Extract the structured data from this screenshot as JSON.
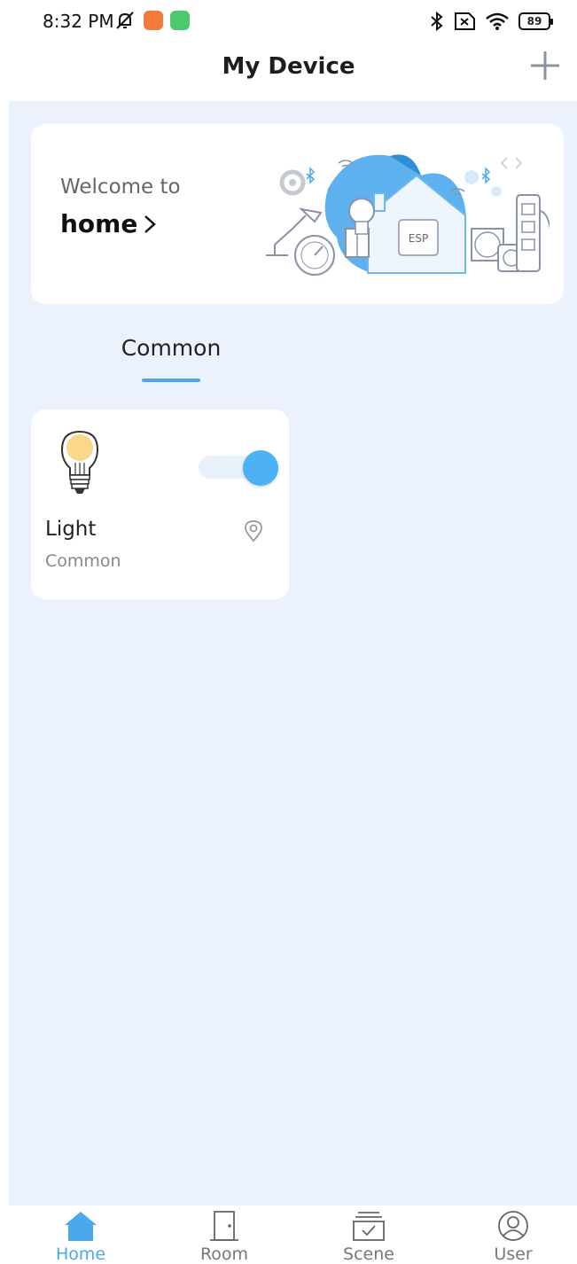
{
  "status_bar": {
    "time": "8:32 PM",
    "battery": "89"
  },
  "header": {
    "title": "My Device",
    "add_icon": "plus-icon"
  },
  "welcome": {
    "greeting": "Welcome to",
    "home_label": "home",
    "chevron": "›",
    "illustration_label": "ESP"
  },
  "tabs": [
    {
      "label": "Common",
      "active": true
    }
  ],
  "devices": [
    {
      "name": "Light",
      "room": "Common",
      "on": true,
      "icon": "lightbulb-icon"
    }
  ],
  "bottom_nav": {
    "items": [
      {
        "label": "Home",
        "icon": "home-icon",
        "active": true
      },
      {
        "label": "Room",
        "icon": "door-icon",
        "active": false
      },
      {
        "label": "Scene",
        "icon": "scene-icon",
        "active": false
      },
      {
        "label": "User",
        "icon": "user-icon",
        "active": false
      }
    ]
  },
  "colors": {
    "accent": "#4aa8ec",
    "background": "#ebf2fe",
    "toggle_knob": "#4db1f5"
  }
}
